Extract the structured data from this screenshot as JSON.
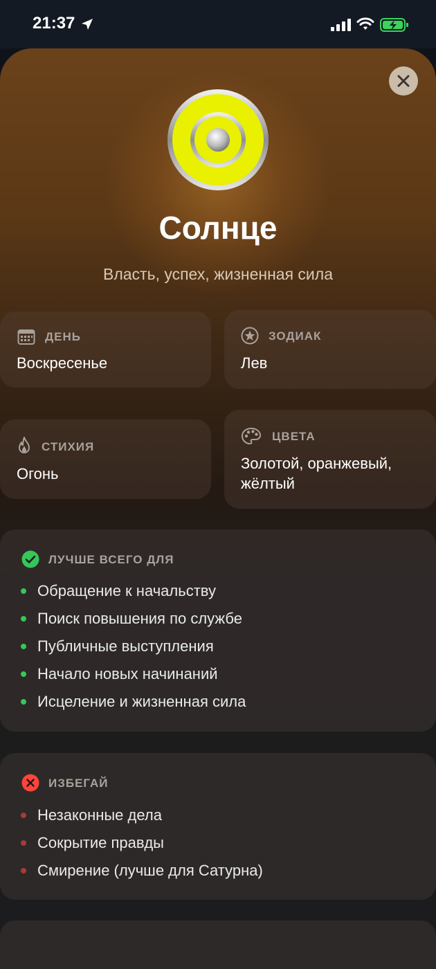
{
  "status": {
    "time": "21:37"
  },
  "planet": {
    "title": "Солнце",
    "subtitle": "Власть, успех, жизненная сила",
    "icon": "sun-planet-icon"
  },
  "info": {
    "day": {
      "label": "ДЕНЬ",
      "value": "Воскресенье",
      "icon": "calendar-icon"
    },
    "zodiac": {
      "label": "ЗОДИАК",
      "value": "Лев",
      "icon": "star-circle-icon"
    },
    "element": {
      "label": "СТИХИЯ",
      "value": "Огонь",
      "icon": "flame-icon"
    },
    "colors": {
      "label": "ЦВЕТА",
      "value": "Золотой, оранжевый, жёлтый",
      "icon": "palette-icon"
    }
  },
  "best_for": {
    "label": "ЛУЧШЕ ВСЕГО ДЛЯ",
    "icon": "checkmark-circle-icon",
    "accent": "#34c759",
    "items": [
      "Обращение к начальству",
      "Поиск повышения по службе",
      "Публичные выступления",
      "Начало новых начинаний",
      "Исцеление и жизненная сила"
    ]
  },
  "avoid": {
    "label": "ИЗБЕГАЙ",
    "icon": "x-circle-icon",
    "accent": "#ff453a",
    "items": [
      "Незаконные дела",
      "Сокрытие правды",
      "Смирение (лучше для Сатурна)"
    ]
  }
}
